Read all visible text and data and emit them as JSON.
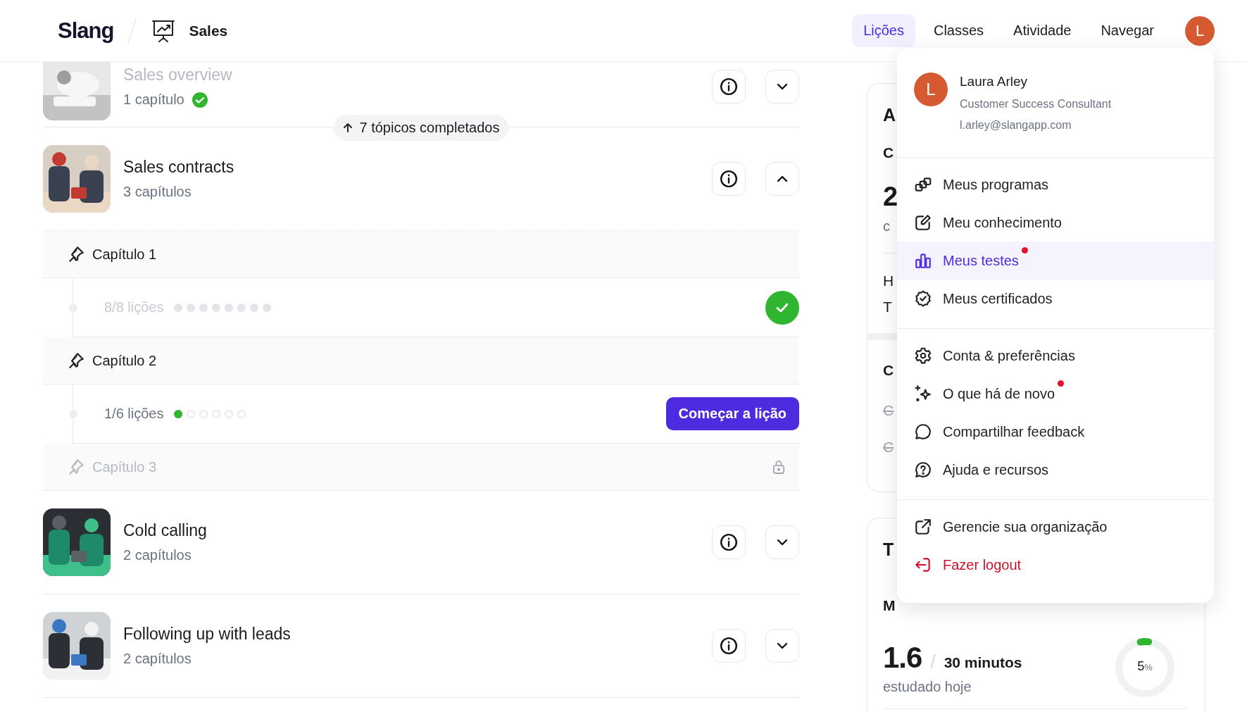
{
  "header": {
    "logo": "Slang",
    "section": "Sales",
    "avatar": "L",
    "nav": [
      {
        "label": "Lições",
        "selected": true
      },
      {
        "label": "Classes",
        "selected": false
      },
      {
        "label": "Atividade",
        "selected": false
      },
      {
        "label": "Navegar",
        "selected": false
      }
    ]
  },
  "completed_courses": [
    {
      "title": "Sales overview",
      "subtitle": "1 capítulo",
      "completed": true,
      "expanded": false
    }
  ],
  "completed_banner": "7 tópicos completados",
  "courses": [
    {
      "title": "Sales contracts",
      "subtitle": "3 capítulos",
      "completed": false,
      "expanded": true,
      "chapters": [
        {
          "title": "Capítulo 1",
          "kind": "completed",
          "progress": "8/8 lições",
          "dots": [
            {
              "done": true
            },
            {
              "done": true
            },
            {
              "done": true
            },
            {
              "done": true
            },
            {
              "done": true
            },
            {
              "done": true
            },
            {
              "done": true
            },
            {
              "done": true
            }
          ]
        },
        {
          "title": "Capítulo 2",
          "kind": "in_progress",
          "progress": "1/6 lições",
          "action": "Começar a lição",
          "dots": [
            {
              "done": true
            },
            {
              "done": false
            },
            {
              "done": false
            },
            {
              "done": false
            },
            {
              "done": false
            },
            {
              "done": false
            }
          ]
        },
        {
          "title": "Capítulo 3",
          "kind": "locked"
        }
      ]
    },
    {
      "title": "Cold calling",
      "subtitle": "2 capítulos",
      "completed": false,
      "expanded": false
    },
    {
      "title": "Following up with leads",
      "subtitle": "2 capítulos",
      "completed": false,
      "expanded": false
    }
  ],
  "side_cards": [
    {
      "items": [
        {
          "kind": "heading",
          "text": "A"
        },
        {
          "kind": "subheading",
          "text": "C"
        },
        {
          "kind": "stat",
          "text": "2"
        },
        {
          "kind": "caption",
          "text": "c"
        },
        {
          "kind": "divider"
        },
        {
          "kind": "line",
          "text": "H"
        },
        {
          "kind": "line",
          "text": "T"
        },
        {
          "kind": "band"
        },
        {
          "kind": "subheading",
          "text": "C"
        },
        {
          "kind": "struck",
          "text": "C"
        },
        {
          "kind": "struck",
          "text": "C"
        }
      ]
    },
    {
      "items": [
        {
          "kind": "heading",
          "text": "T"
        },
        {
          "kind": "subheading",
          "text": "M"
        }
      ],
      "goal": {
        "value": "1.6",
        "separator": "/",
        "target": "30 minutos",
        "caption": "estudado hoje",
        "percent": "5",
        "percent_unit": "%",
        "level": 0.05
      }
    }
  ],
  "menu": {
    "avatar": "L",
    "name": "Laura Arley",
    "role": "Customer Success Consultant",
    "email": "l.arley@slangapp.com",
    "groups": [
      {
        "items": [
          {
            "label": "Meus programas",
            "kind": "normal",
            "selected": false,
            "notification": false
          },
          {
            "label": "Meu conhecimento",
            "kind": "normal",
            "selected": false,
            "notification": false
          },
          {
            "label": "Meus testes",
            "kind": "normal",
            "selected": true,
            "notification": true
          },
          {
            "label": "Meus certificados",
            "kind": "normal",
            "selected": false,
            "notification": false
          }
        ]
      },
      {
        "items": [
          {
            "label": "Conta & preferências",
            "kind": "normal",
            "selected": false,
            "notification": false
          },
          {
            "label": "O que há de novo",
            "kind": "normal",
            "selected": false,
            "notification": true
          },
          {
            "label": "Compartilhar feedback",
            "kind": "normal",
            "selected": false,
            "notification": false
          },
          {
            "label": "Ajuda e recursos",
            "kind": "normal",
            "selected": false,
            "notification": false
          }
        ]
      },
      {
        "items": [
          {
            "label": "Gerencie sua organização",
            "kind": "normal",
            "selected": false,
            "notification": false
          },
          {
            "label": "Fazer logout",
            "kind": "danger",
            "selected": false,
            "notification": false
          }
        ]
      }
    ]
  }
}
